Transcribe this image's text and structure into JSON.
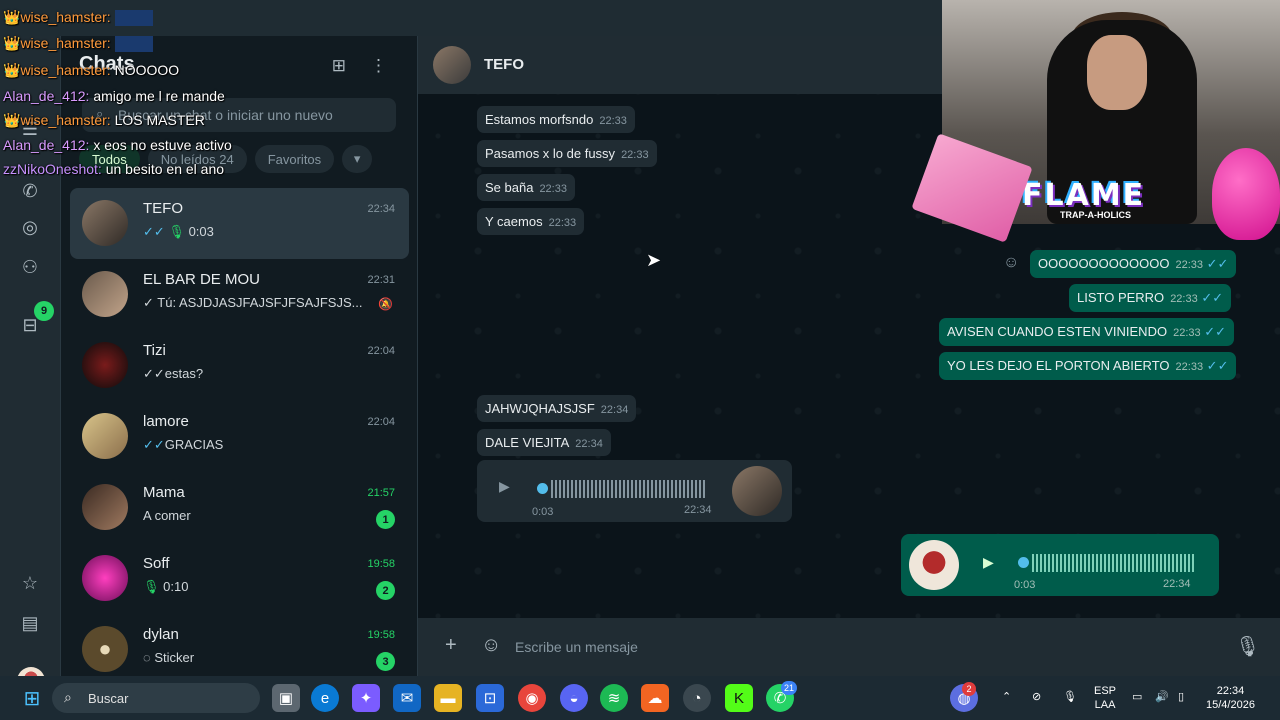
{
  "sidebar": {
    "title": "Chats",
    "search_placeholder": "Buscar un chat o iniciar uno nuevo",
    "filters": [
      "Todos",
      "No leídos 24",
      "Favoritos"
    ],
    "chats": [
      {
        "name": "TEFO",
        "time": "22:34",
        "preview": "0:03",
        "selected": true
      },
      {
        "name": "EL BAR DE MOU",
        "time": "22:31",
        "preview": "Tú: ASJDJASJFAJSFJFSAJFSJS..."
      },
      {
        "name": "Tizi",
        "time": "22:04",
        "preview": "estas?"
      },
      {
        "name": "lamore",
        "time": "22:04",
        "preview": "GRACIAS"
      },
      {
        "name": "Mama",
        "time": "21:57",
        "preview": "A comer",
        "unread": "1"
      },
      {
        "name": "Soff",
        "time": "19:58",
        "preview": "0:10",
        "unread": "2"
      },
      {
        "name": "dylan",
        "time": "19:58",
        "preview": "Sticker",
        "unread": "3"
      }
    ]
  },
  "rail": {
    "archive_badge": "9"
  },
  "conversation": {
    "contact": "TEFO",
    "incoming_1": [
      {
        "text": "Estamos morfsndo",
        "time": "22:33"
      },
      {
        "text": "Pasamos x lo de fussy",
        "time": "22:33"
      },
      {
        "text": "Se baña",
        "time": "22:33"
      },
      {
        "text": "Y caemos",
        "time": "22:33"
      }
    ],
    "outgoing": [
      {
        "text": "OOOOOOOOOOOOO",
        "time": "22:33"
      },
      {
        "text": "LISTO PERRO",
        "time": "22:33"
      },
      {
        "text": "AVISEN CUANDO ESTEN VINIENDO",
        "time": "22:33"
      },
      {
        "text": "YO LES DEJO EL PORTON ABIERTO",
        "time": "22:33"
      }
    ],
    "incoming_2": [
      {
        "text": "JAHWJQHAJSJSF",
        "time": "22:34"
      },
      {
        "text": "DALE VIEJITA",
        "time": "22:34"
      }
    ],
    "voice_in": {
      "duration": "0:03",
      "time": "22:34"
    },
    "voice_out": {
      "duration": "0:03",
      "time": "22:34"
    },
    "composer_placeholder": "Escribe un mensaje"
  },
  "stream_chat": [
    {
      "user": "wise_hamster:",
      "msg": ""
    },
    {
      "user": "wise_hamster:",
      "msg": ""
    },
    {
      "user": "wise_hamster:",
      "msg": "NOOOOO"
    },
    {
      "user": "Alan_de_412:",
      "msg": "amigo me l re mande"
    },
    {
      "user": "wise_hamster:",
      "msg": "LOS MASTER"
    },
    {
      "user": "Alan_de_412:",
      "msg": "x eos no estuve activo"
    },
    {
      "user": "zzNikoOneshot:",
      "msg": "un besito en el ano"
    }
  ],
  "webcam": {
    "logo": "FLAME",
    "logo_sub": "TRAP-A-HOLICS"
  },
  "taskbar": {
    "search": "Buscar",
    "lang_1": "ESP",
    "lang_2": "LAA",
    "clock": "22:34",
    "date": "15/4/2026",
    "whatsapp_badge": "21",
    "tray_badge": "2"
  }
}
